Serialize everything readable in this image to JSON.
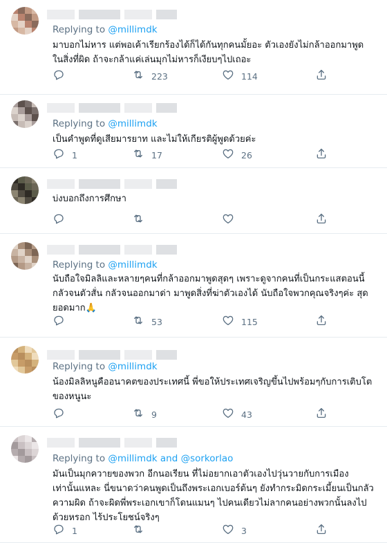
{
  "replying_to_label": "Replying to",
  "tweets": [
    {
      "reply_mentions": "@millimdk",
      "text": "มาบอกไม่หาร แต่พอเค้าเรียกร้องได้ก็ได้กันทุกคนมั้ยอะ ตัวเองยังไม่กล้าออกมาพูด\nในสิ่งที่ผิด ถ้าจะกล้าแค่เล่นมุกไม่หารก็เงียบๆไปเถอะ",
      "counts": {
        "reply": "",
        "retweet": "223",
        "like": "114"
      }
    },
    {
      "reply_mentions": "@millimdk",
      "text": "เป็นคำพูดที่ดูเสียมารยาท และไม่ให้เกียรติผู้พูดด้วยค่ะ",
      "counts": {
        "reply": "1",
        "retweet": "17",
        "like": "26"
      }
    },
    {
      "reply_mentions": "",
      "text": "บ่งบอกถึงการศึกษา",
      "counts": {
        "reply": "",
        "retweet": "",
        "like": ""
      }
    },
    {
      "reply_mentions": "@millimdk",
      "text": "นับถือใจมิลลิและหลายๆคนที่กล้าออกมาพูดสุดๆ เพราะดูจากคนที่เป็นกระแสตอนนี้\nกลัวจนตัวสั่น กลัวจนออกมาด่า มาพูดสิ่งที่ฆ่าตัวเองได้ นับถือใจพวกคุณจริงๆค่ะ สุด\nยอดมาก🙏",
      "counts": {
        "reply": "",
        "retweet": "53",
        "like": "115"
      }
    },
    {
      "reply_mentions": "@millimdk",
      "text": "น้องมิลลิหนูคืออนาคตของประเทศนี้ พี่ขอให้ประเทศเจริญขึ้นไปพร้อมๆกับการเติบโต\nของหนูนะ",
      "counts": {
        "reply": "",
        "retweet": "9",
        "like": "43"
      }
    },
    {
      "reply_mentions": "@millimdk and @sorkorlao",
      "text": "มันเป็นมุกควายของพวก อีกนอเรียน ที่ไม่อยากเอาตัวเองไปวุ่นวายกับการเมือง\nเท่านั้นแหละ นี่ขนาดว่าคนพูดเป็นถึงพระเอกเบอร์ต้นๆ ยังทำกระมิดกระเมี้ยนเป็นกลัว\nความผิด ถ้าจะผิดพี่พระเอกเขาก็โดนแมนๆ ไปคนเดียวไม่ลากคนอย่างพวกนั้นลงไป\nด้วยหรอก ไร้ประโยชน์จริงๆ",
      "counts": {
        "reply": "1",
        "retweet": "",
        "like": "3"
      }
    }
  ]
}
